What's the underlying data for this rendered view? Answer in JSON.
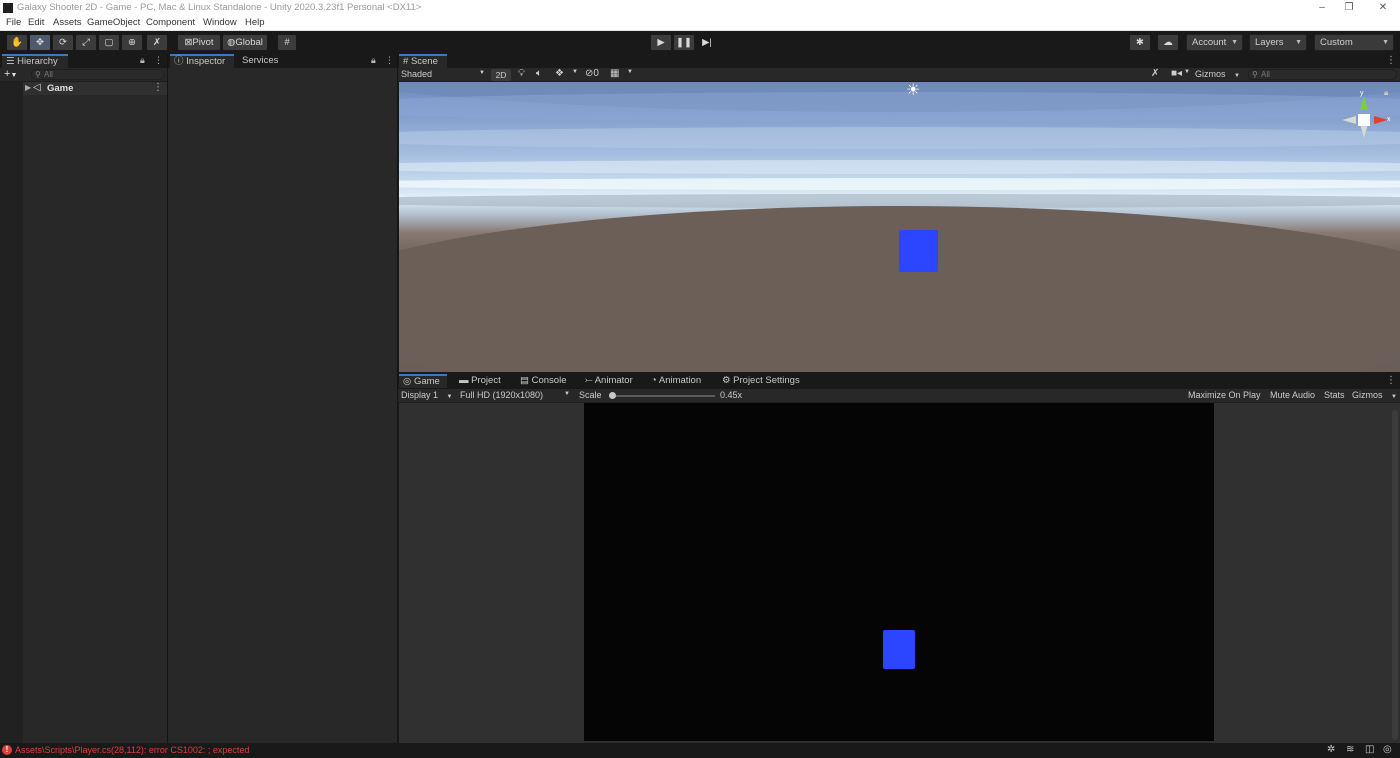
{
  "window": {
    "title": "Galaxy Shooter 2D - Game - PC, Mac & Linux Standalone - Unity 2020.3.23f1 Personal <DX11>",
    "controls": [
      "–",
      "❐",
      "✕"
    ]
  },
  "menu": [
    "File",
    "Edit",
    "Assets",
    "GameObject",
    "Component",
    "Window",
    "Help"
  ],
  "toolbar": {
    "pivot_label": "Pivot",
    "global_label": "Global",
    "account_label": "Account",
    "layers_label": "Layers",
    "layout_label": "Custom"
  },
  "hierarchy": {
    "tab_label": "Hierarchy",
    "add_label": "+",
    "search_placeholder": "All",
    "scene_name": "Game"
  },
  "inspector": {
    "tab_label": "Inspector",
    "services_label": "Services"
  },
  "scene": {
    "tab_label": "Scene",
    "shading_label": "Shaded",
    "mode_2d_label": "2D",
    "hidden_count": "0",
    "gizmos_label": "Gizmos",
    "search_placeholder": "All"
  },
  "bottom_tabs": [
    {
      "label": "Game",
      "icon": "gamepad-icon"
    },
    {
      "label": "Project",
      "icon": "folder-icon"
    },
    {
      "label": "Console",
      "icon": "console-icon"
    },
    {
      "label": "Animator",
      "icon": "animator-icon"
    },
    {
      "label": "Animation",
      "icon": "animation-icon"
    },
    {
      "label": "Project Settings",
      "icon": "gear-icon"
    }
  ],
  "game": {
    "display_label": "Display 1",
    "resolution_label": "Full HD (1920x1080)",
    "scale_label": "Scale",
    "scale_value": "0.45x",
    "maximize_label": "Maximize On Play",
    "mute_label": "Mute Audio",
    "stats_label": "Stats",
    "gizmos_label": "Gizmos"
  },
  "status": {
    "error_text": "Assets\\Scripts\\Player.cs(28,112): error CS1002: ; expected"
  },
  "colors": {
    "accent": "#3a79bb",
    "cube": "#2c46ff",
    "error": "#d9423c"
  }
}
